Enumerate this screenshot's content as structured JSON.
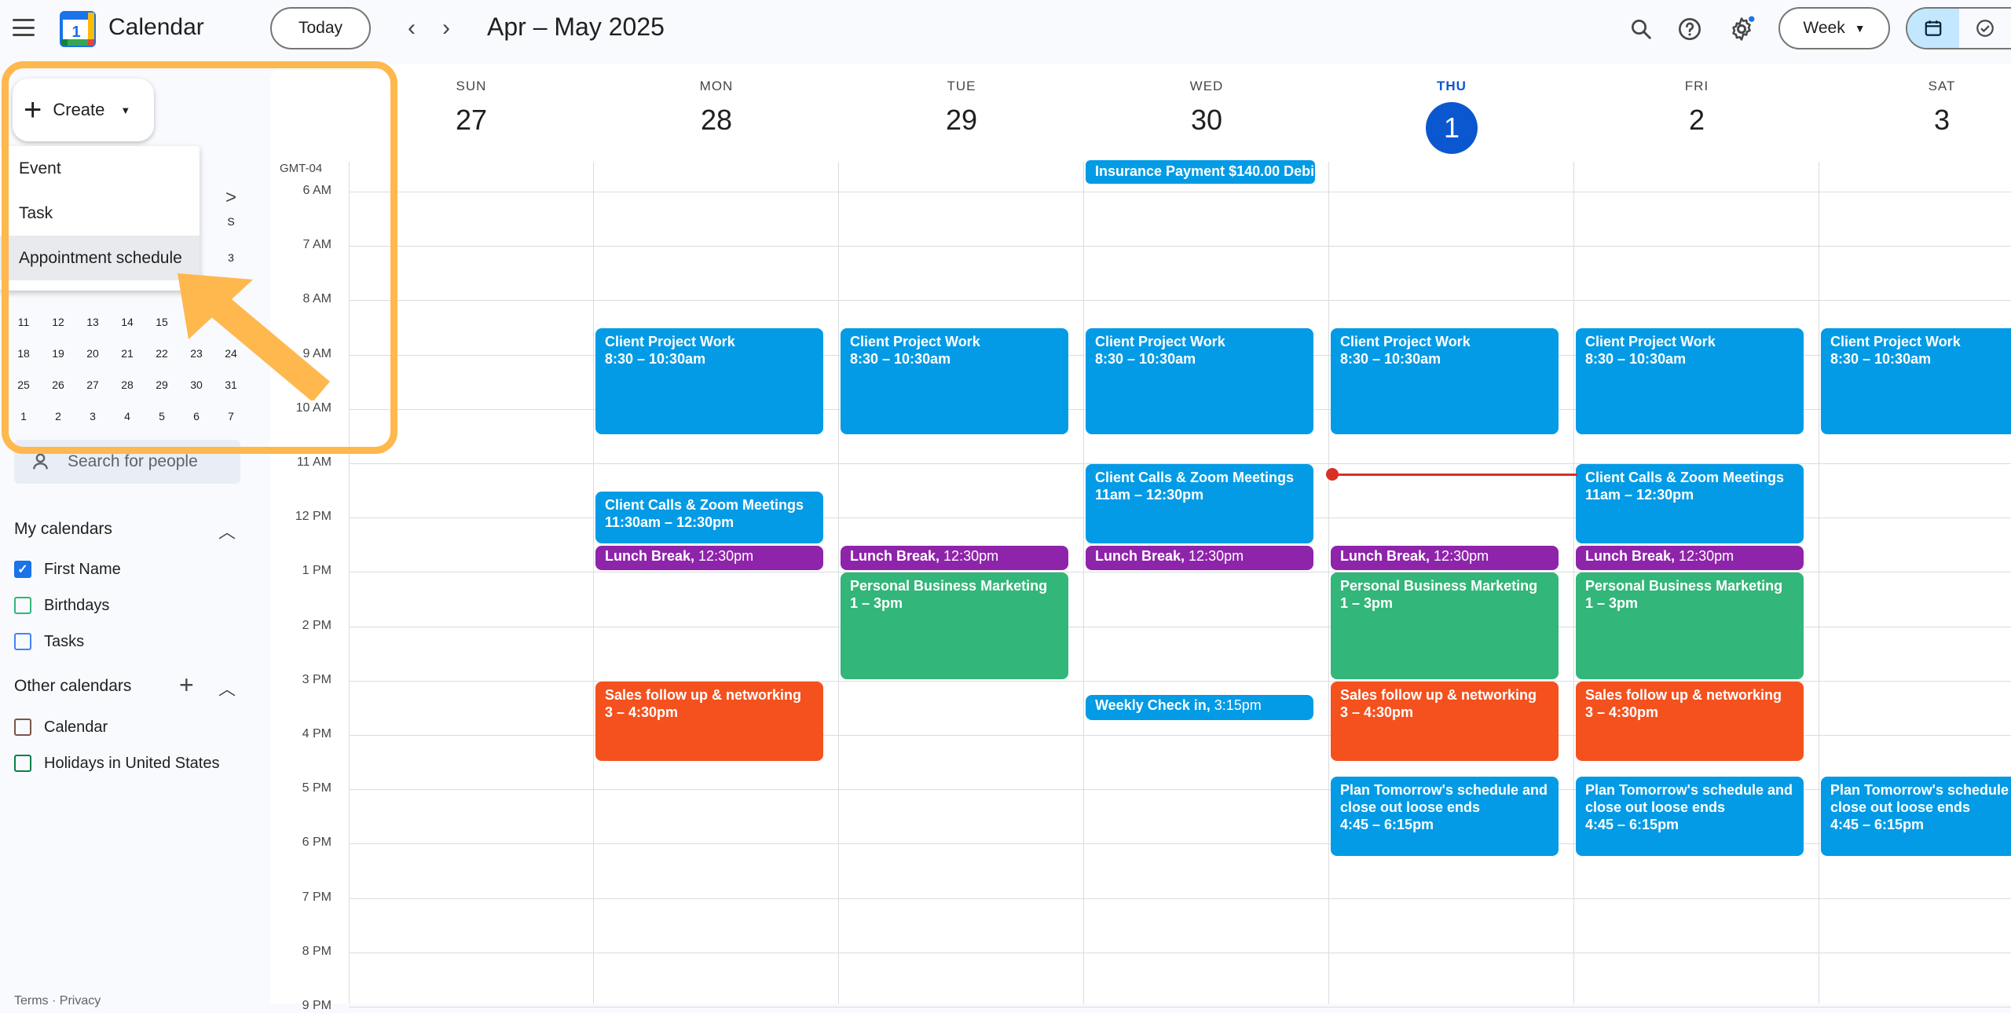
{
  "header": {
    "app_title": "Calendar",
    "logo_day": "1",
    "today_label": "Today",
    "date_range": "Apr – May 2025",
    "view_label": "Week"
  },
  "sidebar": {
    "create_label": "Create",
    "create_menu": [
      "Event",
      "Task",
      "Appointment schedule"
    ],
    "mini_cal": {
      "partial_rows": [
        {
          "cells": [
            "",
            "",
            "",
            "",
            "",
            "",
            ">"
          ]
        },
        {
          "cells": [
            "",
            "",
            "",
            "",
            "",
            "",
            "S"
          ]
        },
        {
          "cells": [
            "",
            "",
            "",
            "",
            "",
            "",
            "3"
          ]
        }
      ],
      "rows": [
        [
          "11",
          "12",
          "13",
          "14",
          "15",
          "",
          ""
        ],
        [
          "18",
          "19",
          "20",
          "21",
          "22",
          "23",
          "24"
        ],
        [
          "25",
          "26",
          "27",
          "28",
          "29",
          "30",
          "31"
        ],
        [
          "1",
          "2",
          "3",
          "4",
          "5",
          "6",
          "7"
        ]
      ]
    },
    "search_people_placeholder": "Search for people",
    "my_calendars_title": "My calendars",
    "my_calendars": [
      {
        "name": "First Name",
        "color": "#1a73e8",
        "checked": true
      },
      {
        "name": "Birthdays",
        "color": "#33b679",
        "checked": false
      },
      {
        "name": "Tasks",
        "color": "#4285f4",
        "checked": false
      }
    ],
    "other_calendars_title": "Other calendars",
    "other_calendars": [
      {
        "name": "Calendar",
        "color": "#795548",
        "checked": false
      },
      {
        "name": "Holidays in United States",
        "color": "#0b8043",
        "checked": false
      }
    ],
    "footer": "Terms · Privacy"
  },
  "grid": {
    "timezone": "GMT-04",
    "days": [
      {
        "name": "SUN",
        "num": "27"
      },
      {
        "name": "MON",
        "num": "28"
      },
      {
        "name": "TUE",
        "num": "29"
      },
      {
        "name": "WED",
        "num": "30"
      },
      {
        "name": "THU",
        "num": "1",
        "today": true
      },
      {
        "name": "FRI",
        "num": "2"
      },
      {
        "name": "SAT",
        "num": "3"
      }
    ],
    "hours": [
      "6 AM",
      "7 AM",
      "8 AM",
      "9 AM",
      "10 AM",
      "11 AM",
      "12 PM",
      "1 PM",
      "2 PM",
      "3 PM",
      "4 PM",
      "5 PM",
      "6 PM",
      "7 PM",
      "8 PM",
      "9 PM"
    ],
    "all_day_event": {
      "title": "Insurance Payment $140.00 Debi",
      "day": 3
    },
    "events": {
      "client_project": {
        "title": "Client Project Work",
        "time": "8:30 – 10:30am"
      },
      "client_calls_mon": {
        "title": "Client Calls & Zoom Meetings",
        "time": "11:30am – 12:30pm"
      },
      "client_calls": {
        "title": "Client Calls & Zoom Meetings",
        "time": "11am – 12:30pm"
      },
      "lunch": {
        "title": "Lunch Break",
        "time": "12:30pm"
      },
      "marketing": {
        "title": "Personal Business Marketing",
        "time": "1 – 3pm"
      },
      "weekly_check": {
        "title": "Weekly Check in",
        "time": "3:15pm"
      },
      "sales": {
        "title": "Sales follow up & networking",
        "time": "3 – 4:30pm"
      },
      "plan": {
        "title": "Plan Tomorrow's schedule and close out loose ends",
        "time": "4:45 – 6:15pm"
      }
    }
  },
  "colors": {
    "blue": "#039be5",
    "purple": "#8e24aa",
    "green": "#33b679",
    "orange": "#f4511e",
    "highlight": "#ffb84d",
    "now_line": "#d93025"
  }
}
